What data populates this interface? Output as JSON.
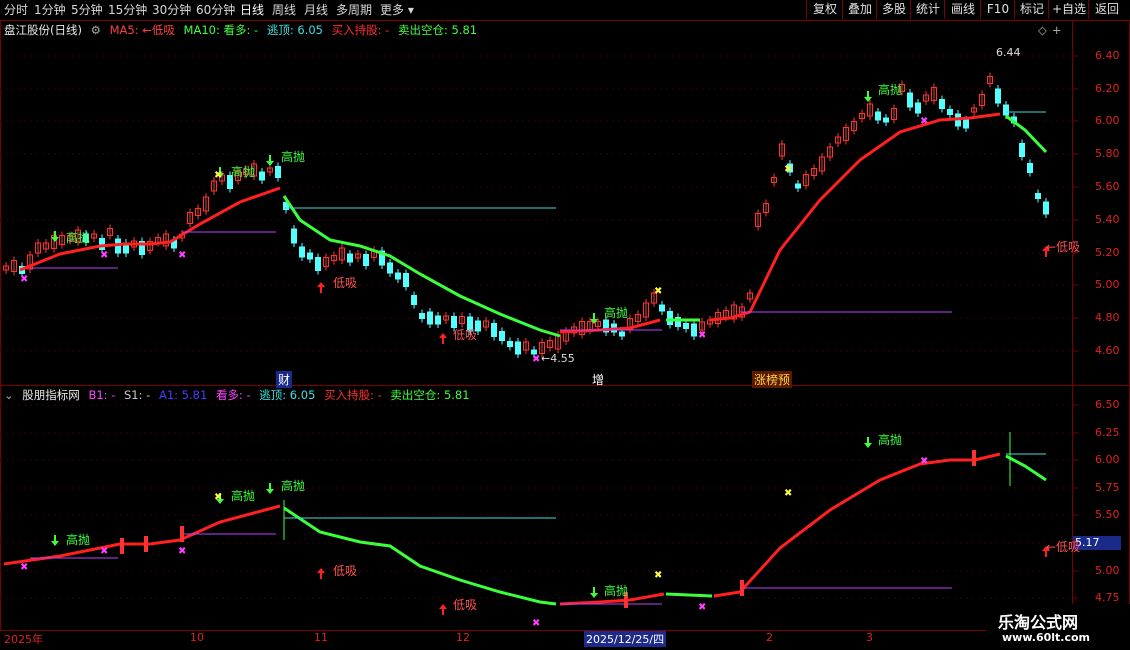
{
  "toolbar": {
    "left_tabs": [
      "分时",
      "1分钟",
      "5分钟",
      "15分钟",
      "30分钟",
      "60分钟",
      "日线",
      "周线",
      "月线",
      "多周期",
      "更多"
    ],
    "active_tab": "日线",
    "right_buttons": [
      "复权",
      "叠加",
      "多股",
      "统计",
      "画线",
      "F10",
      "标记",
      "+自选",
      "返回"
    ]
  },
  "upper": {
    "title": "盘江股份(日线)",
    "items": [
      {
        "label": "MA5: ←低吸",
        "color": "#ff4040"
      },
      {
        "label": "MA10: 看多: -",
        "color": "#ff40ff"
      },
      {
        "label": "逃顶: 6.05",
        "color": "#40e0e0"
      },
      {
        "label": "买入持股: -",
        "color": "#ff3030"
      },
      {
        "label": "卖出空仓: 5.81",
        "color": "#40ff40"
      }
    ],
    "y_ticks": [
      "6.40",
      "6.20",
      "6.00",
      "5.80",
      "5.60",
      "5.40",
      "5.20",
      "5.00",
      "4.80",
      "4.60"
    ],
    "annotations": {
      "high": "6.44",
      "low": "←4.55",
      "buy": "低吸",
      "sell": "高抛",
      "dip_right": "←低吸"
    },
    "event_markers": [
      "财",
      "增",
      "涨榜预"
    ]
  },
  "lower": {
    "title": "股朋指标网",
    "items": [
      {
        "label": "B1: -",
        "color": "#ff40ff"
      },
      {
        "label": "S1: -",
        "color": "#c8c8c8"
      },
      {
        "label": "A1: 5.81",
        "color": "#4040ff"
      },
      {
        "label": "看多: -",
        "color": "#ff40ff"
      },
      {
        "label": "逃顶: 6.05",
        "color": "#40e0e0"
      },
      {
        "label": "买入持股: -",
        "color": "#ff3030"
      },
      {
        "label": "卖出空仓: 5.81",
        "color": "#40ff40"
      }
    ],
    "y_ticks": [
      "6.50",
      "6.25",
      "6.00",
      "5.75",
      "5.50",
      "5.25",
      "5.00",
      "4.75"
    ],
    "current_value": "5.17"
  },
  "x_axis": [
    "2025年",
    "10",
    "11",
    "12",
    "2025/12/25/四",
    "2",
    "3"
  ],
  "watermark": {
    "title": "乐淘公式网",
    "url": "www.60lt.com"
  },
  "colors": {
    "up": "#ff3232",
    "down": "#54ffff",
    "trend_up": "#ff2020",
    "trend_down": "#3cff3c",
    "grid": "#7a0000",
    "axis_text": "#d22222"
  }
}
